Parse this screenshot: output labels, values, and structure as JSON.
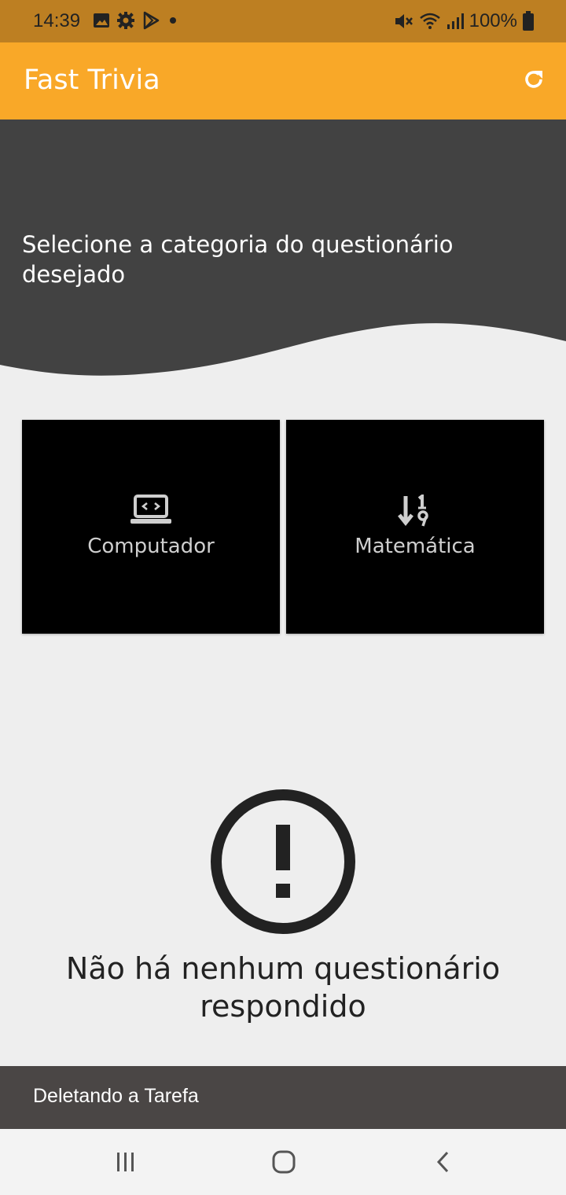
{
  "status_bar": {
    "time": "14:39",
    "battery": "100%",
    "icons": [
      "image-icon",
      "gear-icon",
      "play-store-icon",
      "dot-icon",
      "mute-icon",
      "wifi-icon",
      "signal-icon",
      "battery-icon"
    ]
  },
  "app_bar": {
    "title": "Fast Trivia",
    "action_icon": "refresh-icon",
    "color": "#f9a828"
  },
  "hero": {
    "prompt": "Selecione a categoria do questionário desejado",
    "color": "#424242"
  },
  "categories": [
    {
      "label": "Computador",
      "icon": "laptop-code-icon"
    },
    {
      "label": "Matemática",
      "icon": "sort-numeric-icon"
    }
  ],
  "empty_state": {
    "icon": "warning-circle-icon",
    "message": "Não há nenhum questionário respondido"
  },
  "snackbar": {
    "message": "Deletando a Tarefa"
  },
  "nav_bar": {
    "buttons": [
      "recent-apps-icon",
      "home-icon",
      "back-icon"
    ]
  }
}
